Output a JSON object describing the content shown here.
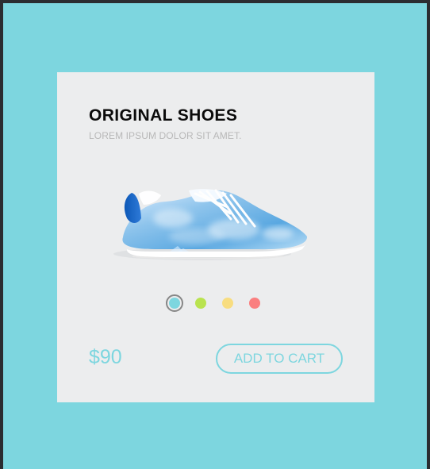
{
  "product": {
    "title": "ORIGINAL SHOES",
    "subtitle": "LOREM IPSUM DOLOR SIT AMET.",
    "price": "$90",
    "cart_button_label": "ADD TO CART"
  },
  "colors": {
    "page_background": "#7dd6df",
    "card_background": "#ecedee",
    "accent": "#7dd6df",
    "title": "#0b0b0b",
    "subtitle": "#b8b8b8"
  },
  "swatches": [
    {
      "color": "#7dd6df",
      "selected": true
    },
    {
      "color": "#b9e34f",
      "selected": false
    },
    {
      "color": "#f8dd80",
      "selected": false
    },
    {
      "color": "#fa7f7f",
      "selected": false
    }
  ],
  "image": {
    "icon": "sneaker-image"
  }
}
